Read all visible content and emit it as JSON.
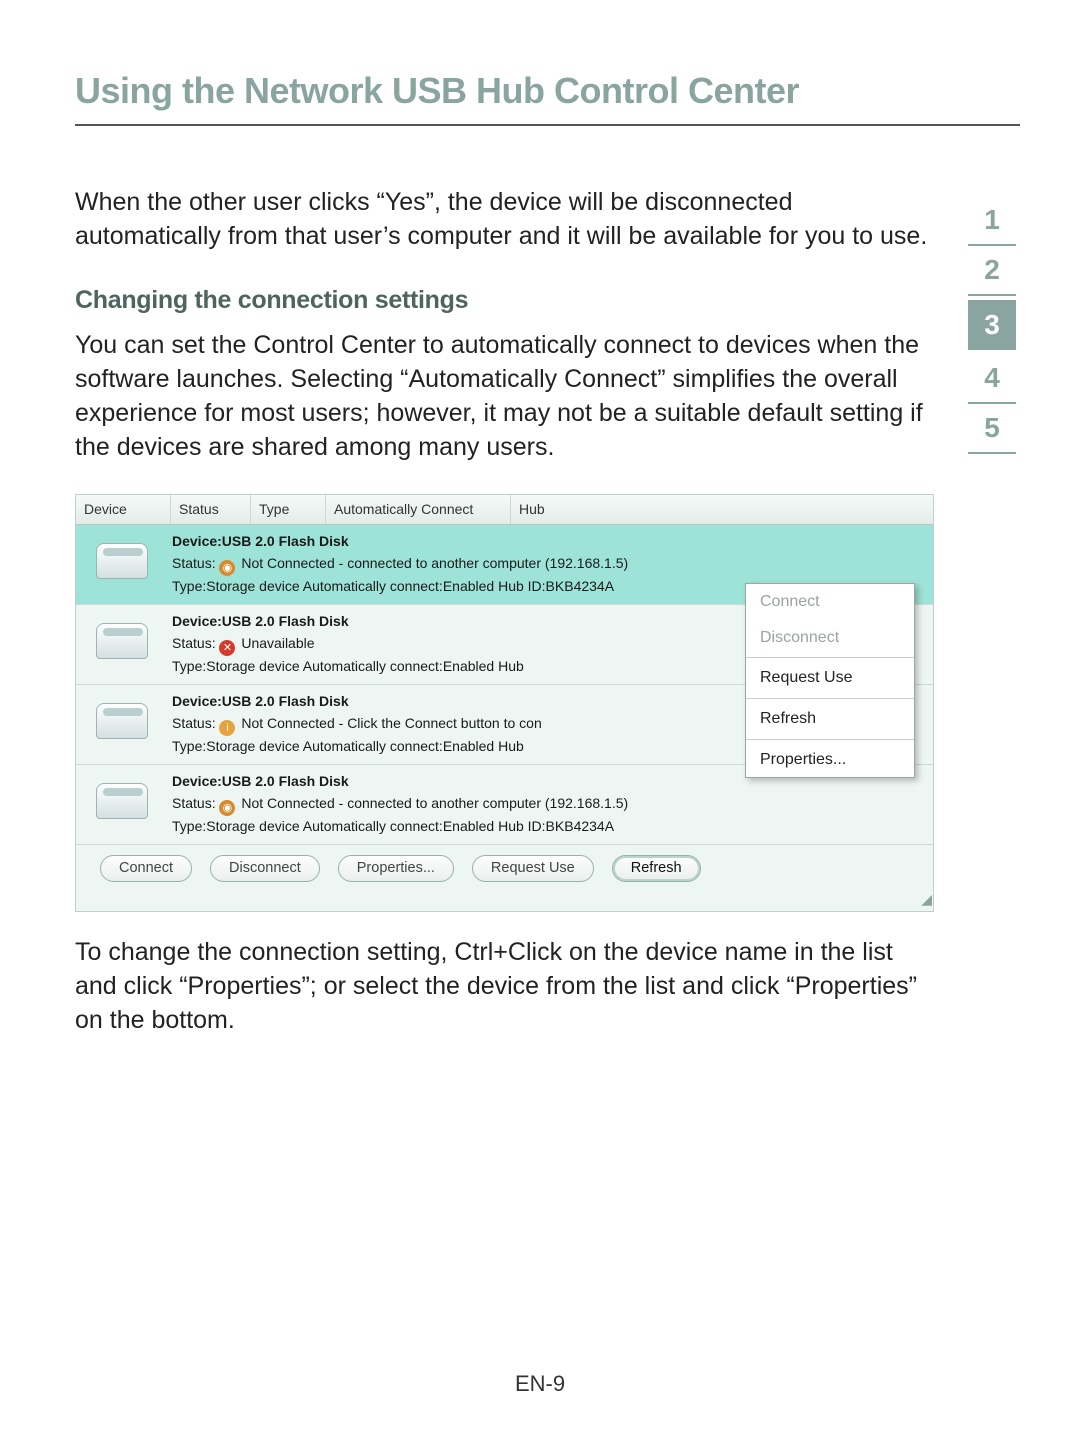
{
  "title": "Using the Network USB Hub Control Center",
  "intro": "When the other user clicks “Yes”, the device will be disconnected automatically from that user’s computer and it will be available for you to use.",
  "subheading": "Changing the connection settings",
  "body1": "You can set the Control Center to automatically connect to devices when the software launches. Selecting “Automatically Connect” simplifies the overall experience for most users; however, it may not be a suitable default setting if the devices are shared among many users.",
  "body2": "To change the connection setting, Ctrl+Click on the device name in the list and click “Properties”; or select the device from the list and click “Properties” on the bottom.",
  "page_number": "EN-9",
  "section_tabs": [
    "1",
    "2",
    "3",
    "4",
    "5"
  ],
  "active_tab_index": 2,
  "app": {
    "columns": {
      "device": "Device",
      "status": "Status",
      "type": "Type",
      "auto": "Automatically Connect",
      "hub": "Hub"
    },
    "rows": [
      {
        "selected": true,
        "device": "Device:USB 2.0 Flash Disk",
        "status_icon": "user",
        "status_prefix": "Status:  ",
        "status": "Not Connected - connected to another computer (192.168.1.5)",
        "meta": "Type:Storage device   Automatically connect:Enabled   Hub ID:BKB4234A"
      },
      {
        "selected": false,
        "device": "Device:USB 2.0 Flash Disk",
        "status_icon": "x",
        "status_prefix": "Status: ",
        "status": "Unavailable",
        "meta": "Type:Storage device   Automatically connect:Enabled   Hub"
      },
      {
        "selected": false,
        "device": "Device:USB 2.0 Flash Disk",
        "status_icon": "info",
        "status_prefix": "Status: ",
        "status": "Not Connected - Click the Connect button to con",
        "meta": "Type:Storage device   Automatically connect:Enabled   Hub"
      },
      {
        "selected": false,
        "device": "Device:USB 2.0 Flash Disk",
        "status_icon": "user",
        "status_prefix": "Status: ",
        "status": "Not Connected - connected to another computer (192.168.1.5)",
        "meta": "Type:Storage device   Automatically connect:Enabled   Hub ID:BKB4234A"
      }
    ],
    "context_menu": {
      "connect": "Connect",
      "disconnect": "Disconnect",
      "request_use": "Request Use",
      "refresh": "Refresh",
      "properties": "Properties..."
    },
    "buttons": {
      "connect": "Connect",
      "disconnect": "Disconnect",
      "properties": "Properties...",
      "request_use": "Request Use",
      "refresh": "Refresh"
    }
  }
}
